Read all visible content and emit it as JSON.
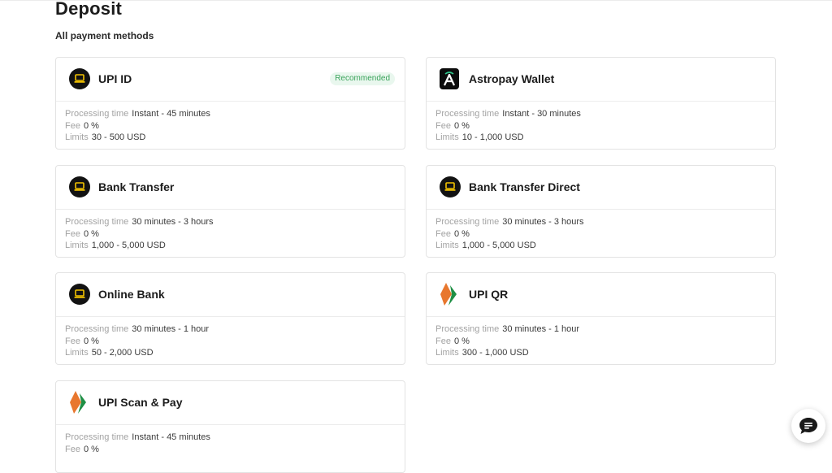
{
  "page": {
    "title": "Deposit",
    "section_label": "All payment methods"
  },
  "labels": {
    "processing": "Processing time",
    "fee": "Fee",
    "limits": "Limits"
  },
  "methods": [
    {
      "name": "UPI ID",
      "icon": "laptop-icon",
      "badge": "Recommended",
      "processing": "Instant - 45 minutes",
      "fee": "0 %",
      "limits": "30 - 500 USD"
    },
    {
      "name": "Astropay Wallet",
      "icon": "astropay-logo-icon",
      "processing": "Instant - 30 minutes",
      "fee": "0 %",
      "limits": "10 - 1,000 USD"
    },
    {
      "name": "Bank Transfer",
      "icon": "laptop-icon",
      "processing": "30 minutes - 3 hours",
      "fee": "0 %",
      "limits": "1,000 - 5,000 USD"
    },
    {
      "name": "Bank Transfer Direct",
      "icon": "laptop-icon",
      "processing": "30 minutes - 3 hours",
      "fee": "0 %",
      "limits": "1,000 - 5,000 USD"
    },
    {
      "name": "Online Bank",
      "icon": "laptop-icon",
      "processing": "30 minutes - 1 hour",
      "fee": "0 %",
      "limits": "50 - 2,000 USD"
    },
    {
      "name": "UPI QR",
      "icon": "upi-logo-icon",
      "processing": "30 minutes - 1 hour",
      "fee": "0 %",
      "limits": "300 - 1,000 USD"
    },
    {
      "name": "UPI Scan & Pay",
      "icon": "upi-logo-icon",
      "processing": "Instant - 45 minutes",
      "fee": "0 %",
      "limits": ""
    }
  ],
  "colors": {
    "badge_text": "#3aa35b",
    "badge_bg": "#e9f7ee",
    "upi_orange": "#e8772e",
    "upi_green": "#1f8f45"
  },
  "chat": {
    "icon": "chat-bubble-icon"
  }
}
